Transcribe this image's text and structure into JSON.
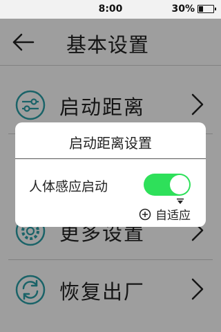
{
  "status_bar": {
    "time": "8:00",
    "battery": "30%",
    "battery_level": 0.3
  },
  "header": {
    "back_icon": "arrow-left-icon",
    "title": "基本设置"
  },
  "menu": {
    "items": [
      {
        "label": "启动距离",
        "icon": "sliders-icon"
      },
      {
        "label": "更多设置",
        "icon": "gear-icon"
      },
      {
        "label": "恢复出厂",
        "icon": "refresh-icon"
      }
    ]
  },
  "dialog": {
    "title": "启动距离设置",
    "setting_label": "人体感应启动",
    "toggle_on": true,
    "adaptive_label": "自适应",
    "adaptive_icon": "plus-circle-icon"
  },
  "colors": {
    "accent_teal": "#2aa0a8",
    "toggle_green": "#2ee05a",
    "overlay": "rgba(0,0,0,0.38)"
  }
}
